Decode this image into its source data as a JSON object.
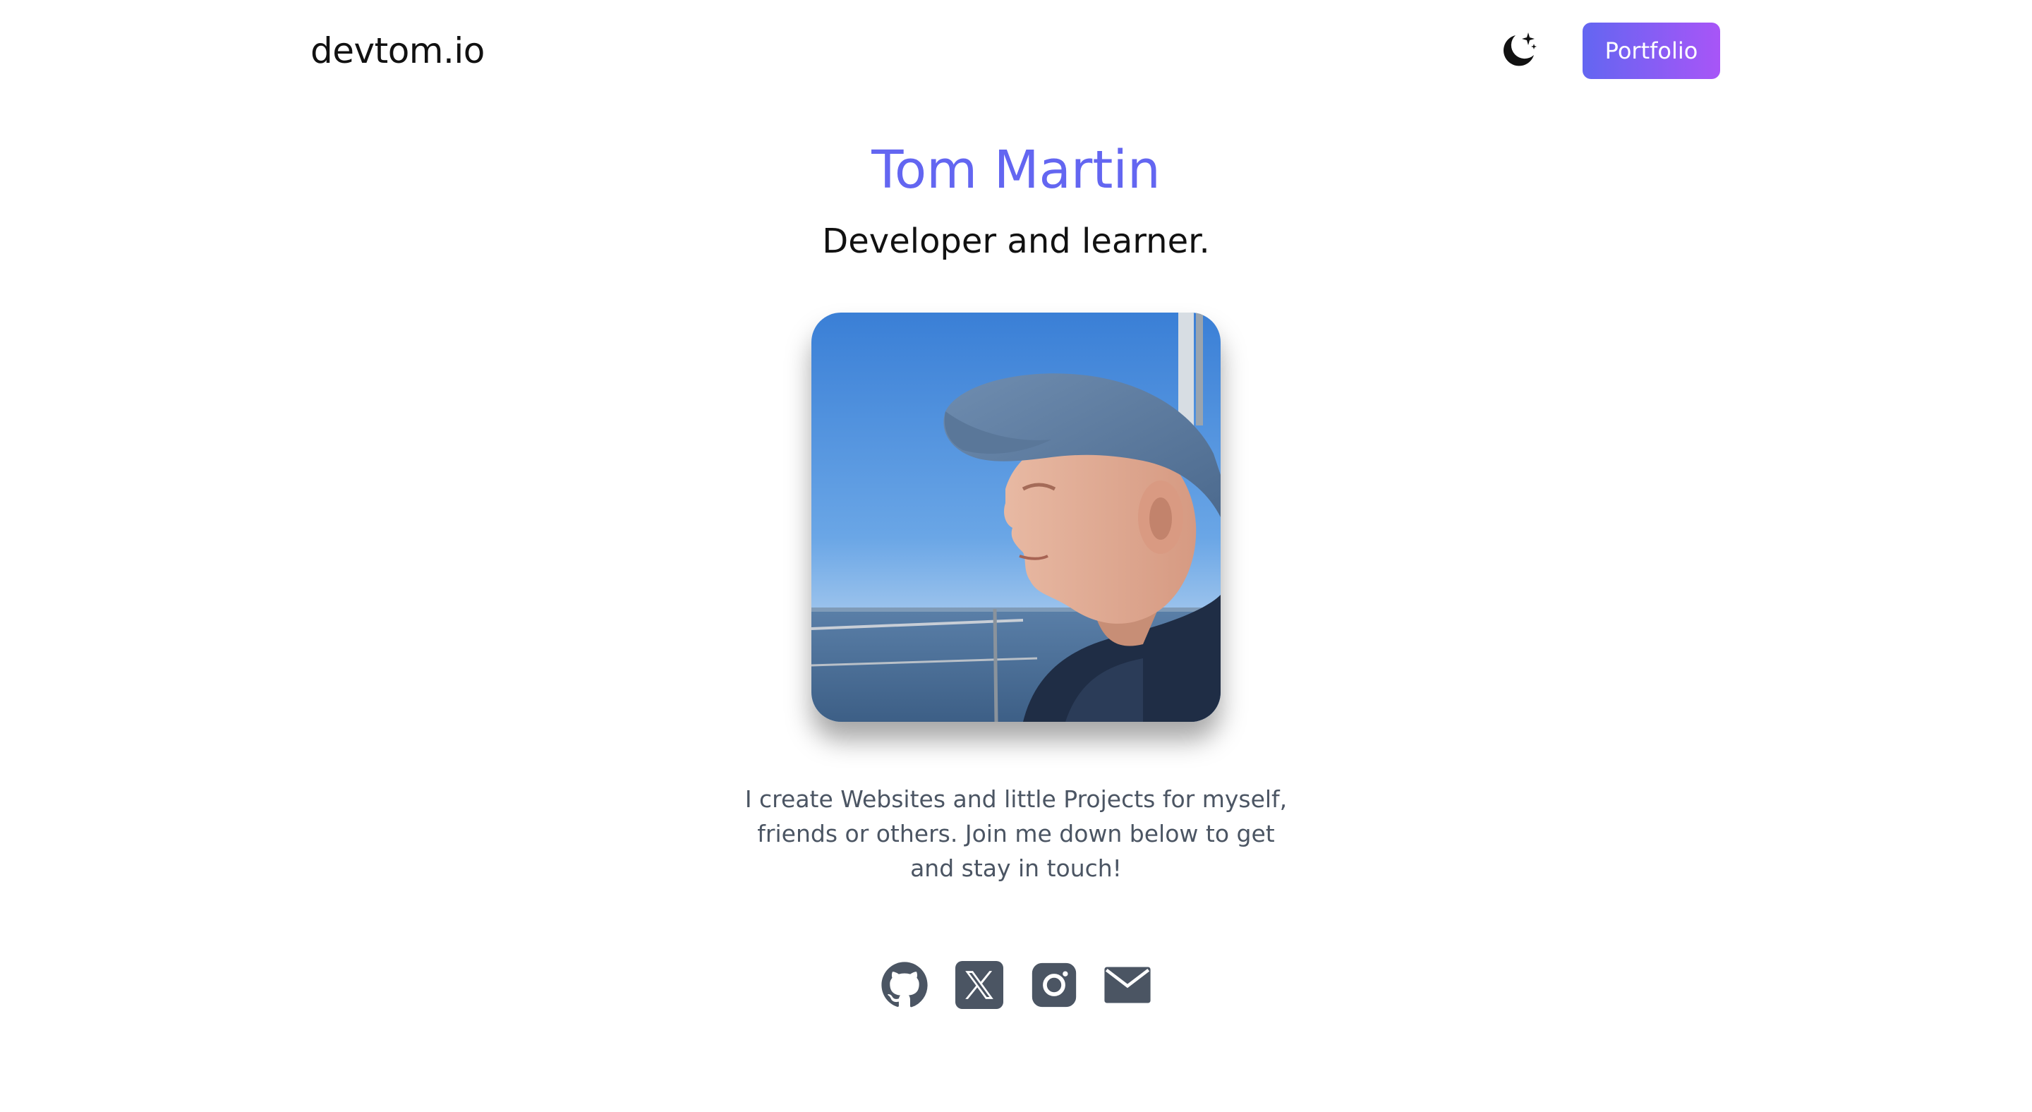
{
  "header": {
    "logo": "devtom.io",
    "theme_toggle_icon": "moon-stars-icon",
    "portfolio_label": "Portfolio"
  },
  "hero": {
    "name": "Tom Martin",
    "tagline": "Developer and learner.",
    "photo_icon": "profile-photo",
    "bio_lines": [
      "I create Websites and little Projects for myself,",
      "friends or others. Join me down below to get",
      "and stay in touch!"
    ]
  },
  "socials": [
    {
      "icon": "github-icon"
    },
    {
      "icon": "x-twitter-icon"
    },
    {
      "icon": "instagram-icon"
    },
    {
      "icon": "mail-icon"
    }
  ],
  "colors": {
    "accent": "#6366f1",
    "button_gradient_start": "#6366f1",
    "button_gradient_end": "#a855f7",
    "icon_color": "#4b5563",
    "body_text": "#4b5563"
  }
}
